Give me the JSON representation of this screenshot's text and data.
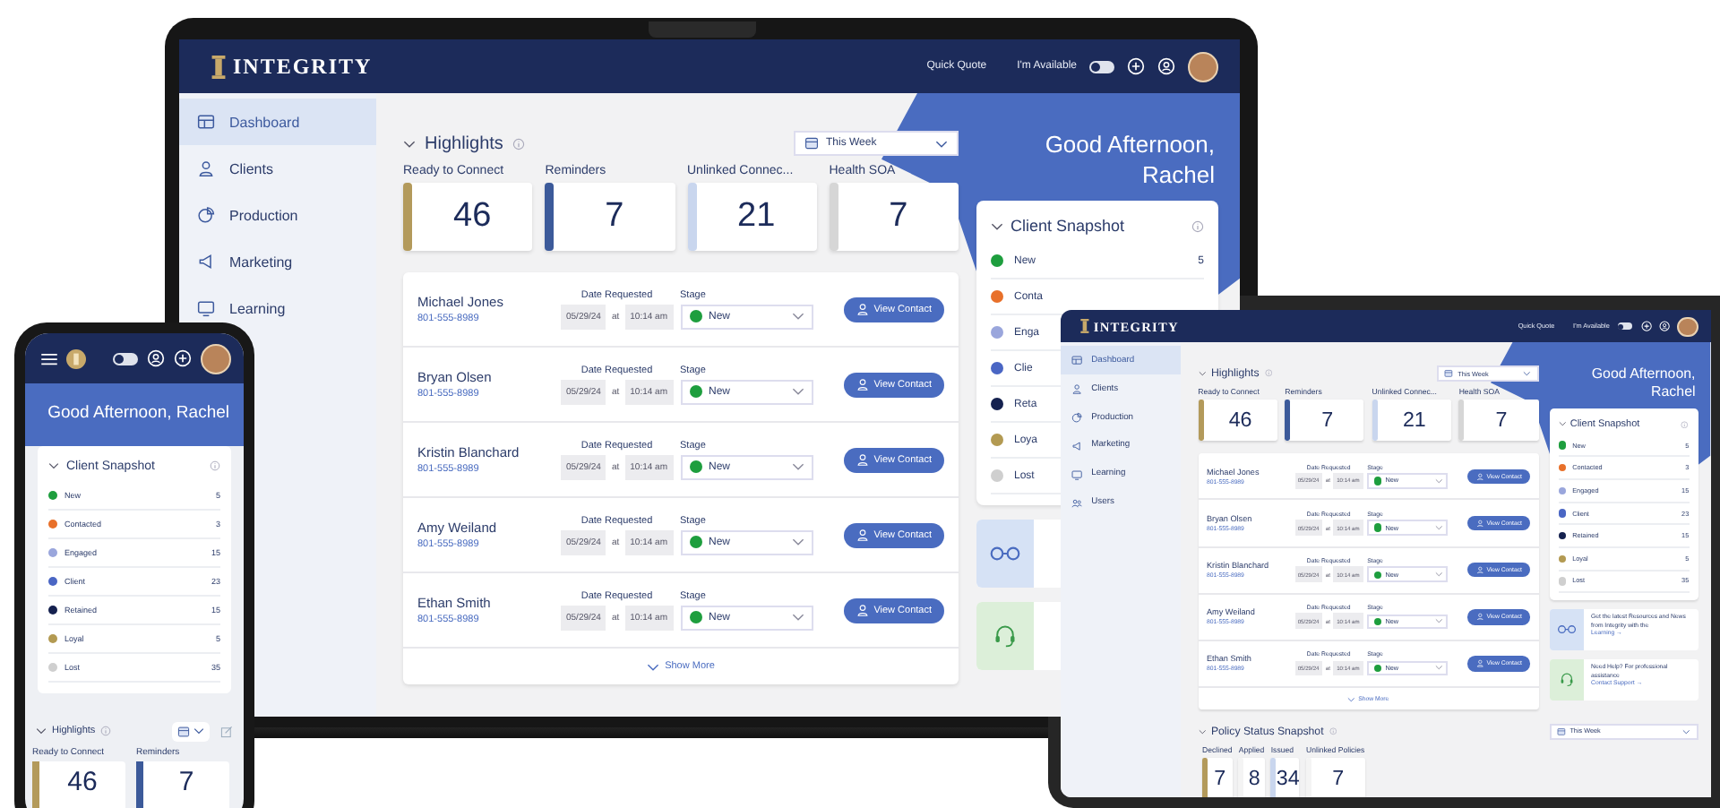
{
  "laptop": {
    "topbar": {
      "logo": "INTEGRITY",
      "quick_quote": "Quick Quote",
      "available_label": "I'm Available",
      "available_on": false
    },
    "sidebar": [
      {
        "label": "Dashboard",
        "selected": true
      },
      {
        "label": "Clients",
        "selected": false
      },
      {
        "label": "Production",
        "selected": false
      },
      {
        "label": "Marketing",
        "selected": false
      },
      {
        "label": "Learning",
        "selected": false
      }
    ],
    "greeting": "Good Afternoon, Rachel",
    "highlights": {
      "title": "Highlights",
      "period": "This Week",
      "show_more": "Show More",
      "cards": [
        {
          "label": "Ready to Connect",
          "value": "46",
          "color": "#b39a5b"
        },
        {
          "label": "Reminders",
          "value": "7",
          "color": "#3c5a9a"
        },
        {
          "label": "Unlinked Connec...",
          "value": "21",
          "color": "#c9d6ee"
        },
        {
          "label": "Health SOA",
          "value": "7",
          "color": "#d6d6d6"
        }
      ],
      "rows": [
        {
          "name": "Michael Jones",
          "phone": "801-555-8989",
          "date_label": "Date Requested",
          "date": "05/29/24",
          "at": "at",
          "time": "10:14 am",
          "stage_label": "Stage",
          "stage": "New",
          "button": "View Contact"
        },
        {
          "name": "Bryan Olsen",
          "phone": "801-555-8989",
          "date_label": "Date Requested",
          "date": "05/29/24",
          "at": "at",
          "time": "10:14 am",
          "stage_label": "Stage",
          "stage": "New",
          "button": "View Contact"
        },
        {
          "name": "Kristin Blanchard",
          "phone": "801-555-8989",
          "date_label": "Date Requested",
          "date": "05/29/24",
          "at": "at",
          "time": "10:14 am",
          "stage_label": "Stage",
          "stage": "New",
          "button": "View Contact"
        },
        {
          "name": "Amy Weiland",
          "phone": "801-555-8989",
          "date_label": "Date Requested",
          "date": "05/29/24",
          "at": "at",
          "time": "10:14 am",
          "stage_label": "Stage",
          "stage": "New",
          "button": "View Contact"
        },
        {
          "name": "Ethan Smith",
          "phone": "801-555-8989",
          "date_label": "Date Requested",
          "date": "05/29/24",
          "at": "at",
          "time": "10:14 am",
          "stage_label": "Stage",
          "stage": "New",
          "button": "View Contact"
        }
      ]
    },
    "client_snapshot": {
      "title": "Client Snapshot",
      "items": [
        {
          "label": "New",
          "count": "5",
          "color": "#1e9e3e"
        },
        {
          "label": "Conta",
          "color": "#e8702a"
        },
        {
          "label": "Enga",
          "color": "#9aa6dc"
        },
        {
          "label": "Clie",
          "color": "#4a66c4"
        },
        {
          "label": "Reta",
          "color": "#15214f"
        },
        {
          "label": "Loya",
          "color": "#b39a52"
        },
        {
          "label": "Lost",
          "color": "#cfcfcf"
        }
      ]
    },
    "promos": [
      {
        "kind": "glasses"
      },
      {
        "kind": "headset"
      }
    ]
  },
  "tablet": {
    "topbar": {
      "logo": "INTEGRITY",
      "quick_quote": "Quick Quote",
      "available_label": "I'm Available",
      "available_on": false
    },
    "sidebar": [
      {
        "label": "Dashboard",
        "selected": true
      },
      {
        "label": "Clients",
        "selected": false
      },
      {
        "label": "Production",
        "selected": false
      },
      {
        "label": "Marketing",
        "selected": false
      },
      {
        "label": "Learning",
        "selected": false
      },
      {
        "label": "Users",
        "selected": false
      }
    ],
    "greeting": "Good Afternoon, Rachel",
    "highlights": {
      "title": "Highlights",
      "period": "This Week",
      "show_more": "Show More",
      "cards": [
        {
          "label": "Ready to Connect",
          "value": "46",
          "color": "#b39a5b"
        },
        {
          "label": "Reminders",
          "value": "7",
          "color": "#3c5a9a"
        },
        {
          "label": "Unlinked Connec...",
          "value": "21",
          "color": "#c9d6ee"
        },
        {
          "label": "Health SOA",
          "value": "7",
          "color": "#d6d6d6"
        }
      ],
      "rows": [
        {
          "name": "Michael Jones",
          "phone": "801-555-8989",
          "date_label": "Date Requested",
          "date": "05/29/24",
          "at": "at",
          "time": "10:14 am",
          "stage_label": "Stage",
          "stage": "New",
          "button": "View Contact"
        },
        {
          "name": "Bryan Olsen",
          "phone": "801-555-8989",
          "date_label": "Date Requested",
          "date": "05/29/24",
          "at": "at",
          "time": "10:14 am",
          "stage_label": "Stage",
          "stage": "New",
          "button": "View Contact"
        },
        {
          "name": "Kristin Blanchard",
          "phone": "801-555-8989",
          "date_label": "Date Requested",
          "date": "05/29/24",
          "at": "at",
          "time": "10:14 am",
          "stage_label": "Stage",
          "stage": "New",
          "button": "View Contact"
        },
        {
          "name": "Amy Weiland",
          "phone": "801-555-8989",
          "date_label": "Date Requested",
          "date": "05/29/24",
          "at": "at",
          "time": "10:14 am",
          "stage_label": "Stage",
          "stage": "New",
          "button": "View Contact"
        },
        {
          "name": "Ethan Smith",
          "phone": "801-555-8989",
          "date_label": "Date Requested",
          "date": "05/29/24",
          "at": "at",
          "time": "10:14 am",
          "stage_label": "Stage",
          "stage": "New",
          "button": "View Contact"
        }
      ]
    },
    "client_snapshot": {
      "title": "Client Snapshot",
      "items": [
        {
          "label": "New",
          "count": "5",
          "color": "#1e9e3e"
        },
        {
          "label": "Contacted",
          "count": "3",
          "color": "#e8702a"
        },
        {
          "label": "Engaged",
          "count": "15",
          "color": "#9aa6dc"
        },
        {
          "label": "Client",
          "count": "23",
          "color": "#4a66c4"
        },
        {
          "label": "Retained",
          "count": "15",
          "color": "#15214f"
        },
        {
          "label": "Loyal",
          "count": "5",
          "color": "#b39a52"
        },
        {
          "label": "Lost",
          "count": "35",
          "color": "#cfcfcf"
        }
      ]
    },
    "promos": [
      {
        "kind": "glasses",
        "text": "Get the latest Resources and News from Integrity with the",
        "link": "Learning →"
      },
      {
        "kind": "headset",
        "text": "Need Help? For professional assistance",
        "link": "Contact Support →"
      }
    ],
    "policy": {
      "title": "Policy Status Snapshot",
      "period": "This Week",
      "cards": [
        {
          "label": "Declined",
          "value": "7",
          "color": "#b39a5b"
        },
        {
          "label": "Applied",
          "value": "8",
          "color": "#f4f4f4"
        },
        {
          "label": "Issued",
          "value": "34",
          "color": "#c9d6ee"
        },
        {
          "label": "Unlinked Policies",
          "value": "7",
          "color": "#f4f4f4"
        }
      ]
    }
  },
  "phone": {
    "topbar": {
      "available_on": false
    },
    "greeting": "Good Afternoon, Rachel",
    "client_snapshot": {
      "title": "Client Snapshot",
      "items": [
        {
          "label": "New",
          "count": "5",
          "color": "#1e9e3e"
        },
        {
          "label": "Contacted",
          "count": "3",
          "color": "#e8702a"
        },
        {
          "label": "Engaged",
          "count": "15",
          "color": "#9aa6dc"
        },
        {
          "label": "Client",
          "count": "23",
          "color": "#4a66c4"
        },
        {
          "label": "Retained",
          "count": "15",
          "color": "#15214f"
        },
        {
          "label": "Loyal",
          "count": "5",
          "color": "#b39a52"
        },
        {
          "label": "Lost",
          "count": "35",
          "color": "#cfcfcf"
        }
      ]
    },
    "highlights": {
      "title": "Highlights",
      "cards": [
        {
          "label": "Ready to Connect",
          "value": "46",
          "color": "#b39a5b"
        },
        {
          "label": "Reminders",
          "value": "7",
          "color": "#3c5a9a"
        }
      ]
    }
  }
}
